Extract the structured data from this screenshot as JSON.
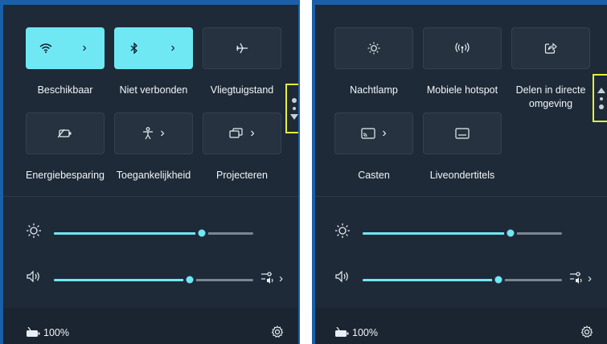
{
  "left_panel": {
    "tiles": [
      {
        "label": "Beschikbaar",
        "icon": "wifi-icon",
        "state": "on",
        "has_chevron": true
      },
      {
        "label": "Niet verbonden",
        "icon": "bluetooth-icon",
        "state": "on",
        "has_chevron": true
      },
      {
        "label": "Vliegtuigstand",
        "icon": "airplane-icon",
        "state": "off",
        "has_chevron": false
      },
      {
        "label": "Energiebesparing",
        "icon": "battery-saver-icon",
        "state": "off",
        "has_chevron": false
      },
      {
        "label": "Toegankelijkheid",
        "icon": "accessibility-icon",
        "state": "off",
        "has_chevron": true
      },
      {
        "label": "Projecteren",
        "icon": "project-icon",
        "state": "off",
        "has_chevron": true
      }
    ],
    "brightness": {
      "icon": "brightness-icon",
      "value": 0.74
    },
    "volume": {
      "icon": "volume-icon",
      "value": 0.68,
      "output_icon": "audio-output-icon"
    },
    "battery": {
      "icon": "battery-charging-icon",
      "text": "100%"
    },
    "settings_icon": "gear-icon",
    "pager": {
      "current_page": 1,
      "pages": 2
    }
  },
  "right_panel": {
    "tiles": [
      {
        "label": "Nachtlamp",
        "icon": "night-light-icon",
        "state": "off",
        "has_chevron": false
      },
      {
        "label": "Mobiele hotspot",
        "icon": "hotspot-icon",
        "state": "off",
        "has_chevron": false
      },
      {
        "label": "Delen in directe omgeving",
        "icon": "nearby-share-icon",
        "state": "off",
        "has_chevron": false
      },
      {
        "label": "Casten",
        "icon": "cast-icon",
        "state": "off",
        "has_chevron": true
      },
      {
        "label": "Liveondertitels",
        "icon": "live-captions-icon",
        "state": "off",
        "has_chevron": false
      }
    ],
    "brightness": {
      "icon": "brightness-icon",
      "value": 0.74
    },
    "volume": {
      "icon": "volume-icon",
      "value": 0.68,
      "output_icon": "audio-output-icon"
    },
    "battery": {
      "icon": "battery-charging-icon",
      "text": "100%"
    },
    "settings_icon": "gear-icon",
    "pager": {
      "current_page": 2,
      "pages": 2
    }
  },
  "colors": {
    "panel_bg": "#1e2a38",
    "accent": "#6fe8f4",
    "tile_bg": "#26323f",
    "highlight": "#e4f03a",
    "border_blue": "#1a5fa8"
  }
}
